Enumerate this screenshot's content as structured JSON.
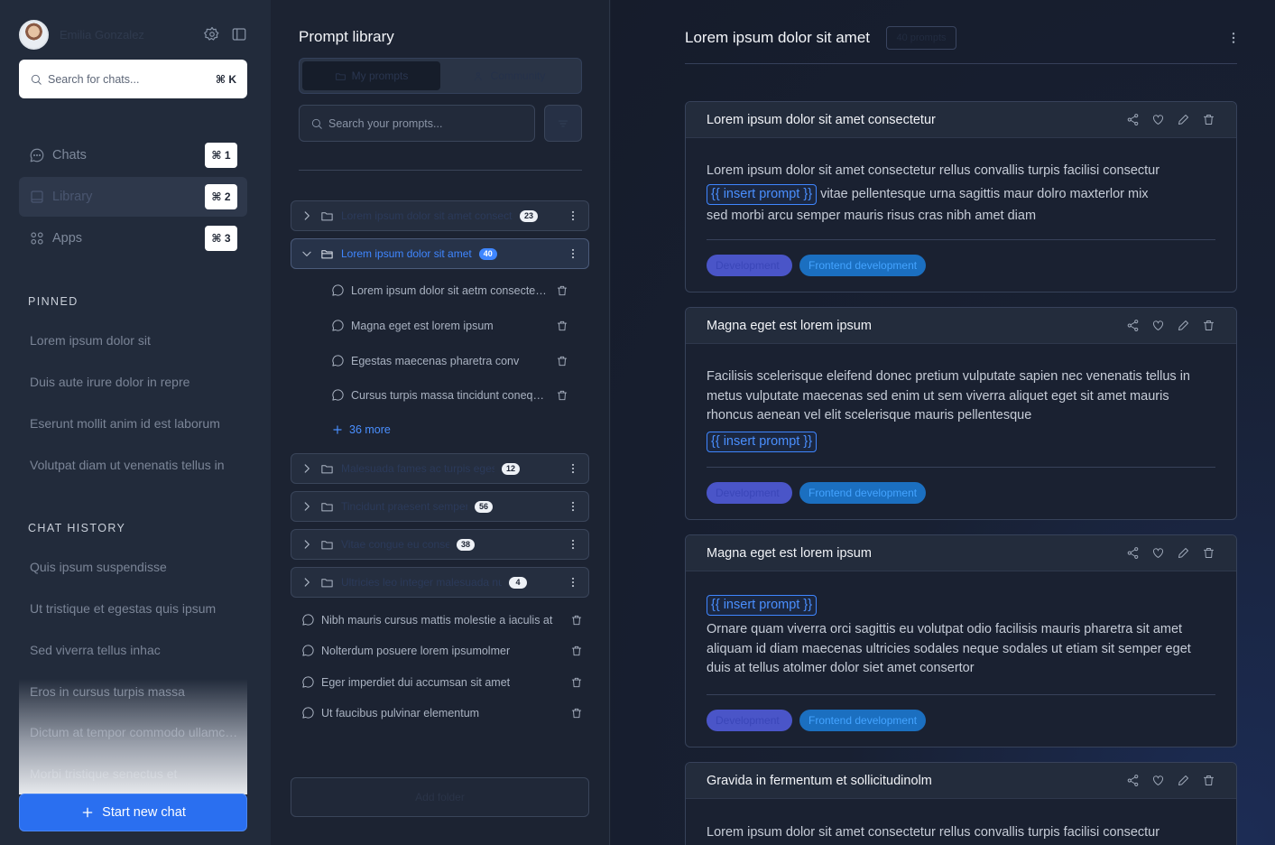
{
  "sidebar": {
    "user_name": "Emilia Gonzalez",
    "search_placeholder": "Search for chats...",
    "search_shortcut": "⌘ K",
    "nav": [
      {
        "label": "Chats",
        "shortcut": "⌘ 1"
      },
      {
        "label": "Library",
        "shortcut": "⌘ 2"
      },
      {
        "label": "Apps",
        "shortcut": "⌘ 3"
      }
    ],
    "pinned_title": "PINNED",
    "pinned": [
      "Lorem ipsum dolor sit",
      "Duis aute irure dolor in repre",
      "Eserunt mollit anim id est laborum",
      "Volutpat diam ut venenatis tellus in"
    ],
    "history_title": "CHAT HISTORY",
    "history": [
      "Quis ipsum suspendisse",
      "Ut tristique et egestas quis ipsum",
      "Sed viverra tellus inhac",
      "Eros in cursus turpis massa",
      "Dictum at tempor commodo ullamcorper",
      "Morbi tristique senectus et"
    ],
    "start_chat": "Start new chat"
  },
  "library": {
    "title": "Prompt library",
    "seg_tabs": [
      "My prompts",
      "Community"
    ],
    "search_placeholder": "Search your prompts...",
    "folders_top": [
      {
        "name": "Lorem ipsum dolor sit amet consectetur",
        "count": "23"
      },
      {
        "name": "Lorem ipsum dolor sit amet",
        "count": "40"
      }
    ],
    "open_items": [
      "Lorem ipsum dolor sit aetm consectetur",
      "Magna eget est lorem ipsum",
      "Egestas maecenas pharetra conv",
      "Cursus turpis massa tincidunt conequat"
    ],
    "more_label": "36 more",
    "folders_bottom": [
      {
        "name": "Malesuada fames ac turpis egestas",
        "count": "12"
      },
      {
        "name": "Tincidunt praesent semper feugiat",
        "count": "56"
      },
      {
        "name": "Vitae congue eu consequat",
        "count": "38"
      },
      {
        "name": "Ultricies leo integer malesuada nunc vel",
        "count": "4"
      }
    ],
    "loose_items": [
      "Nibh mauris cursus mattis molestie a iaculis at",
      "Nolterdum posuere lorem ipsumolmer",
      "Eger imperdiet dui accumsan sit amet",
      "Ut faucibus pulvinar elementum"
    ],
    "bottom_button": "Add folder"
  },
  "main": {
    "title": "Lorem ipsum dolor sit amet",
    "title_tag": "40 prompts",
    "insert_token": "{{ insert prompt }}",
    "tag_1": "Development",
    "tag_2": "Frontend development",
    "cards": [
      {
        "title": "Lorem ipsum dolor sit amet consectetur",
        "line1": "Lorem ipsum dolor sit amet consectetur rellus convallis turpis facilisi consectur",
        "after_token": "vitae pellentesque urna sagittis maur dolro maxterlor mix",
        "line3": "sed morbi arcu semper mauris risus cras nibh amet diam"
      },
      {
        "title": "Magna eget est lorem ipsum",
        "text": "Facilisis scelerisque eleifend donec pretium vulputate sapien nec venenatis tellus in metus vulputate maecenas sed enim ut sem viverra aliquet eget sit amet mauris rhoncus aenean vel elit scelerisque mauris pellentesque"
      },
      {
        "title": "Magna eget est lorem ipsum",
        "text": "Ornare quam viverra orci sagittis eu volutpat odio facilisis mauris pharetra sit amet aliquam id diam maecenas ultricies sodales neque sodales ut etiam sit semper eget duis at tellus atolmer dolor siet amet consertor"
      },
      {
        "title": "Gravida in fermentum et sollicitudinolm",
        "text": "Lorem ipsum dolor sit amet consectetur rellus convallis turpis facilisi  consectur"
      }
    ]
  },
  "colors": {
    "accent": "#2a6ff0",
    "link": "#3f86ff",
    "tag_purple": "#4a55c8",
    "tag_blue": "#1b6fc0"
  }
}
